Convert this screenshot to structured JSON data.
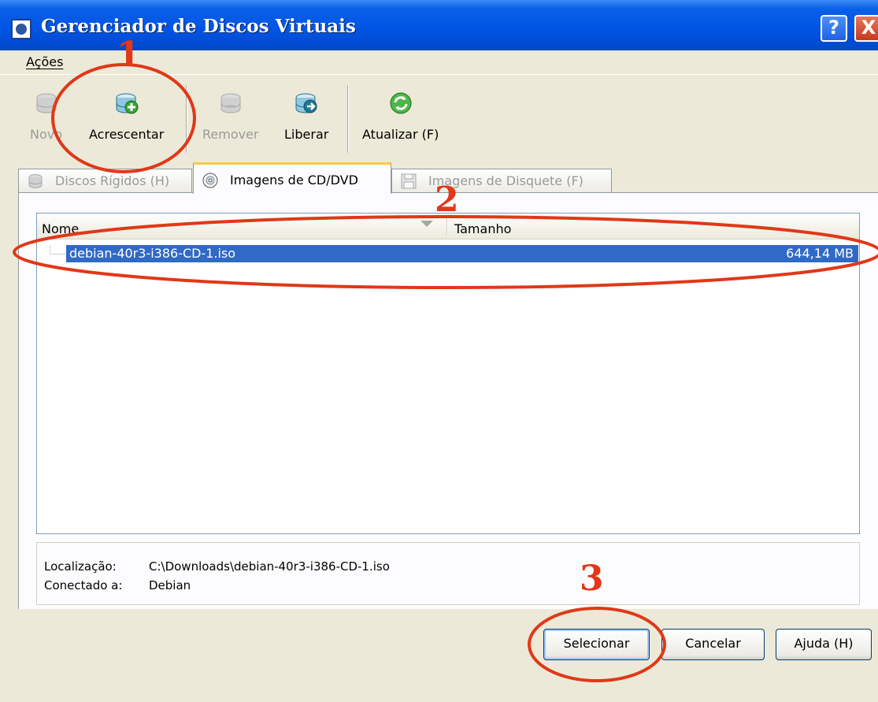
{
  "window": {
    "title": "Gerenciador de Discos Virtuais",
    "icon": "window-app-icon",
    "help_label": "?",
    "close_label": "X"
  },
  "menu": {
    "items": [
      {
        "label": "Ações"
      }
    ]
  },
  "toolbar": {
    "buttons": [
      {
        "label": "Novo",
        "icon": "new-disk-icon",
        "enabled": false
      },
      {
        "label": "Acrescentar",
        "icon": "add-disk-icon",
        "enabled": true
      },
      {
        "label": "Remover",
        "icon": "remove-disk-icon",
        "enabled": false
      },
      {
        "label": "Liberar",
        "icon": "release-disk-icon",
        "enabled": true
      },
      {
        "label": "Atualizar (F)",
        "icon": "refresh-icon",
        "enabled": true
      }
    ]
  },
  "tabs": [
    {
      "label": "Discos Rígidos (H)",
      "icon": "hard-disk-icon",
      "active": false,
      "enabled": false
    },
    {
      "label": "Imagens de CD/DVD",
      "icon": "cd-icon",
      "active": true,
      "enabled": true
    },
    {
      "label": "Imagens de Disquete (F)",
      "icon": "floppy-icon",
      "active": false,
      "enabled": false
    }
  ],
  "list": {
    "columns": [
      "Nome",
      "Tamanho"
    ],
    "rows": [
      {
        "name": "debian-40r3-i386-CD-1.iso",
        "size": "644,14 MB",
        "selected": true
      }
    ]
  },
  "info": {
    "location_label": "Localização:",
    "location_value": "C:\\Downloads\\debian-40r3-i386-CD-1.iso",
    "attached_label": "Conectado a:",
    "attached_value": "Debian"
  },
  "buttons": {
    "select": "Selecionar",
    "cancel": "Cancelar",
    "help": "Ajuda (H)"
  },
  "annotations": {
    "color": "#e03818",
    "labels": [
      "1",
      "2",
      "3"
    ]
  }
}
